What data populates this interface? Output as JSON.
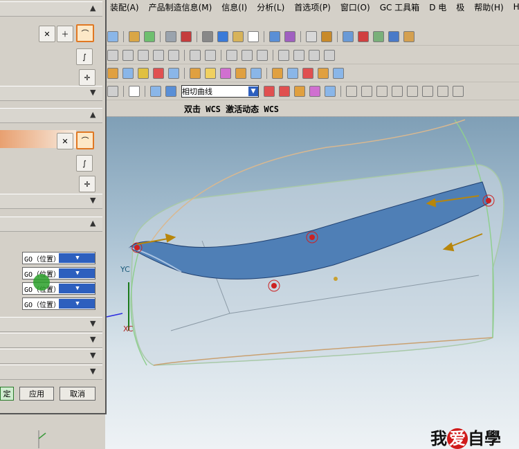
{
  "menubar": {
    "items": [
      "装配(A)",
      "产品制造信息(M)",
      "信息(I)",
      "分析(L)",
      "首选项(P)",
      "窗口(O)",
      "GC 工具箱",
      "D 电",
      "极",
      "帮助(H)",
      "HB"
    ]
  },
  "toolbar": {
    "curve_rule_select": "相切曲线"
  },
  "wcs_hint": "双击 WCS 激活动态 WCS",
  "dialog": {
    "combos": [
      "GO（位置）",
      "GO（位置）",
      "GO（位置）",
      "GO（位置）"
    ],
    "ok_label": "定",
    "apply_label": "应用",
    "cancel_label": "取消"
  },
  "viewport": {
    "axis_labels": {
      "yc": "YC",
      "xc": "XC"
    }
  },
  "watermark": {
    "text_left": "我",
    "text_heart": "爱",
    "text_right": "自學"
  },
  "colors": {
    "surface_blue": "#4f7fb6",
    "handle_red": "#cc2222",
    "arrow_gold": "#b8860b",
    "active_icon_border": "#e07722"
  }
}
